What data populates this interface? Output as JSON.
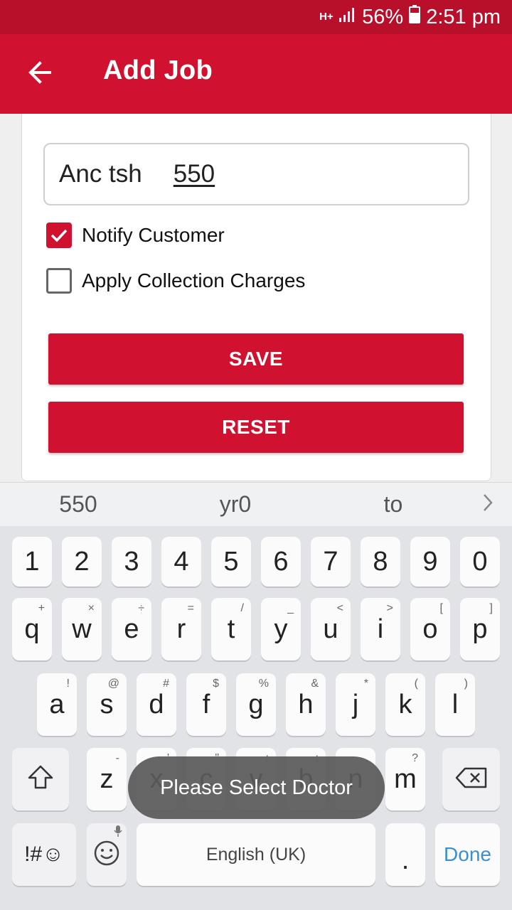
{
  "status": {
    "network": "H+",
    "battery": "56%",
    "time": "2:51 pm"
  },
  "appbar": {
    "title": "Add Job"
  },
  "form": {
    "field": {
      "label": "Anc tsh",
      "value": "550"
    },
    "notify": {
      "label": "Notify Customer",
      "checked": true
    },
    "collection": {
      "label": "Apply Collection Charges",
      "checked": false
    },
    "save_label": "SAVE",
    "reset_label": "RESET"
  },
  "suggestions": [
    "550",
    "yr0",
    "to"
  ],
  "keyboard": {
    "numbers": [
      "1",
      "2",
      "3",
      "4",
      "5",
      "6",
      "7",
      "8",
      "9",
      "0"
    ],
    "row1": [
      {
        "k": "q",
        "h": "+"
      },
      {
        "k": "w",
        "h": "×"
      },
      {
        "k": "e",
        "h": "÷"
      },
      {
        "k": "r",
        "h": "="
      },
      {
        "k": "t",
        "h": "/"
      },
      {
        "k": "y",
        "h": "_"
      },
      {
        "k": "u",
        "h": "<"
      },
      {
        "k": "i",
        "h": ">"
      },
      {
        "k": "o",
        "h": "["
      },
      {
        "k": "p",
        "h": "]"
      }
    ],
    "row2": [
      {
        "k": "a",
        "h": "!"
      },
      {
        "k": "s",
        "h": "@"
      },
      {
        "k": "d",
        "h": "#"
      },
      {
        "k": "f",
        "h": "$"
      },
      {
        "k": "g",
        "h": "%"
      },
      {
        "k": "h",
        "h": "&"
      },
      {
        "k": "j",
        "h": "*"
      },
      {
        "k": "k",
        "h": "("
      },
      {
        "k": "l",
        "h": ")"
      }
    ],
    "row3": [
      {
        "k": "z",
        "h": "-"
      },
      {
        "k": "x",
        "h": "'"
      },
      {
        "k": "c",
        "h": "\""
      },
      {
        "k": "v",
        "h": ":"
      },
      {
        "k": "b",
        "h": ";"
      },
      {
        "k": "n",
        "h": ","
      },
      {
        "k": "m",
        "h": "?"
      }
    ],
    "symbols_label": "!#☺",
    "space_label": "English (UK)",
    "period_label": ".",
    "done_label": "Done"
  },
  "toast": {
    "message": "Please Select Doctor"
  },
  "colors": {
    "primary": "#d01230",
    "status_bar": "#b80f2a",
    "done_text": "#3a8fd0"
  }
}
